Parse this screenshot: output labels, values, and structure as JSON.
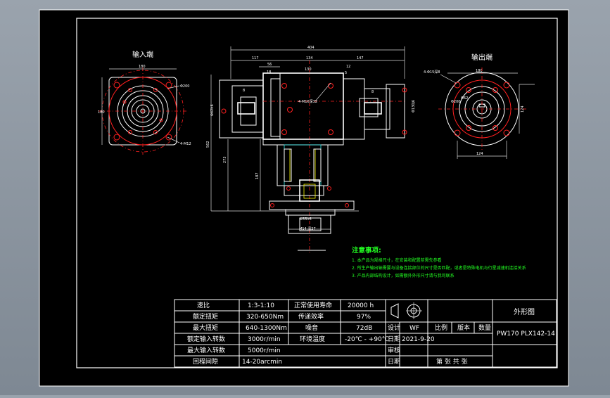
{
  "views": {
    "input_title": "输入端",
    "output_title": "输出端"
  },
  "dims": {
    "front_total": "404",
    "front_a": "117",
    "front_b": "56",
    "front_c": "134",
    "front_d": "147",
    "front_e": "12",
    "front_f": "18",
    "front_g": "130",
    "front_h": "5",
    "front_key": "8",
    "front_side_v": "8",
    "front_hole": "4-M16深32",
    "front_left_v": "Φ42h6",
    "front_right_v": "Φ130j6",
    "front_h1": "562",
    "front_h2": "273",
    "front_h3": "187",
    "front_bottom_a": "Φ35h6",
    "front_bottom_b": "M14 深27",
    "input_w": "180",
    "input_h": "180",
    "input_bolt": "Φ200",
    "input_holes": "4-M12",
    "output_w": "180",
    "output_holes": "4-Φ15深8",
    "output_pcd": "Φ200",
    "output_shaft": "Φ62",
    "output_v": "124",
    "output_h": "124"
  },
  "notes": {
    "title": "注意事项:",
    "lines": [
      "1. 本产品为规格尺寸，在安装和配置前需先参看",
      "2. 所生产输出轴需要与设备连接部位的尺寸是否匹配，或者是特殊电机与行星减速机连接关系",
      "3. 产品内部结构设计，如需额外外形尺寸请与我司联系"
    ]
  },
  "table": {
    "rows": [
      {
        "k1": "速比",
        "v1": "1:3-1:10",
        "k2": "正常使用寿命",
        "v2": "20000 h"
      },
      {
        "k1": "额定扭矩",
        "v1": "320-650Nm",
        "k2": "传递效率",
        "v2": "97%"
      },
      {
        "k1": "最大扭矩",
        "v1": "640-1300Nm",
        "k2": "噪音",
        "v2": "72dB"
      },
      {
        "k1": "额定输入转数",
        "v1": "3000r/min",
        "k2": "环境温度",
        "v2": "-20℃ - +90℃"
      },
      {
        "k1": "最大输入转数",
        "v1": "5000r/min",
        "k2": "",
        "v2": ""
      },
      {
        "k1": "回程间隙",
        "v1": "14-20arcmin",
        "k2": "",
        "v2": ""
      }
    ],
    "drawing_name": "外形图",
    "designer_label": "设计",
    "designer_value": "WF",
    "scale_label": "比例",
    "version_label": "版本",
    "qty_label": "数量",
    "date_label": "日期",
    "date_value": "2021-9-20",
    "model": "PW170  PLX142-14",
    "check_label": "审核",
    "date2_label": "日期",
    "sheet_label": "第    张    共    张"
  }
}
